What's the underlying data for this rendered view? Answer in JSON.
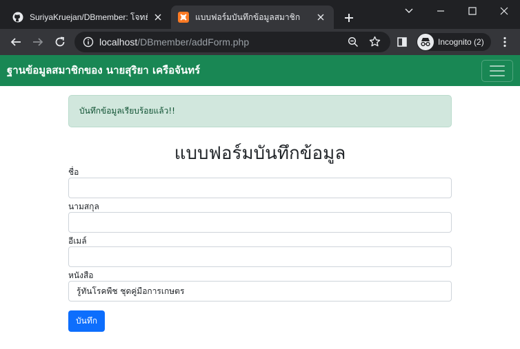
{
  "browser": {
    "tabs": [
      {
        "title": "SuriyaKruejan/DBmember: โจทย์แ",
        "favicon": "github-icon",
        "active": false
      },
      {
        "title": "แบบฟอร์มบันทึกข้อมูลสมาชิก",
        "favicon": "xampp-icon",
        "active": true
      }
    ],
    "url_host": "localhost",
    "url_path": "/DBmember/addForm.php",
    "incognito_label": "Incognito (2)"
  },
  "navbar": {
    "brand": "ฐานข้อมูลสมาชิกของ นายสุริยา เครือจันทร์",
    "color": "#198754"
  },
  "alert": {
    "message": "บันทึกข้อมูลเรียบร้อยแล้ว!!"
  },
  "form": {
    "title": "แบบฟอร์มบันทึกข้อมูล",
    "fields": [
      {
        "label": "ชื่อ",
        "value": ""
      },
      {
        "label": "นามสกุล",
        "value": ""
      },
      {
        "label": "อีเมล์",
        "value": ""
      },
      {
        "label": "หนังสือ",
        "value": "รู้ทันโรคพืช ชุดคู่มือการเกษตร"
      }
    ],
    "submit_label": "บันทึก",
    "submit_color": "#0d6efd"
  }
}
